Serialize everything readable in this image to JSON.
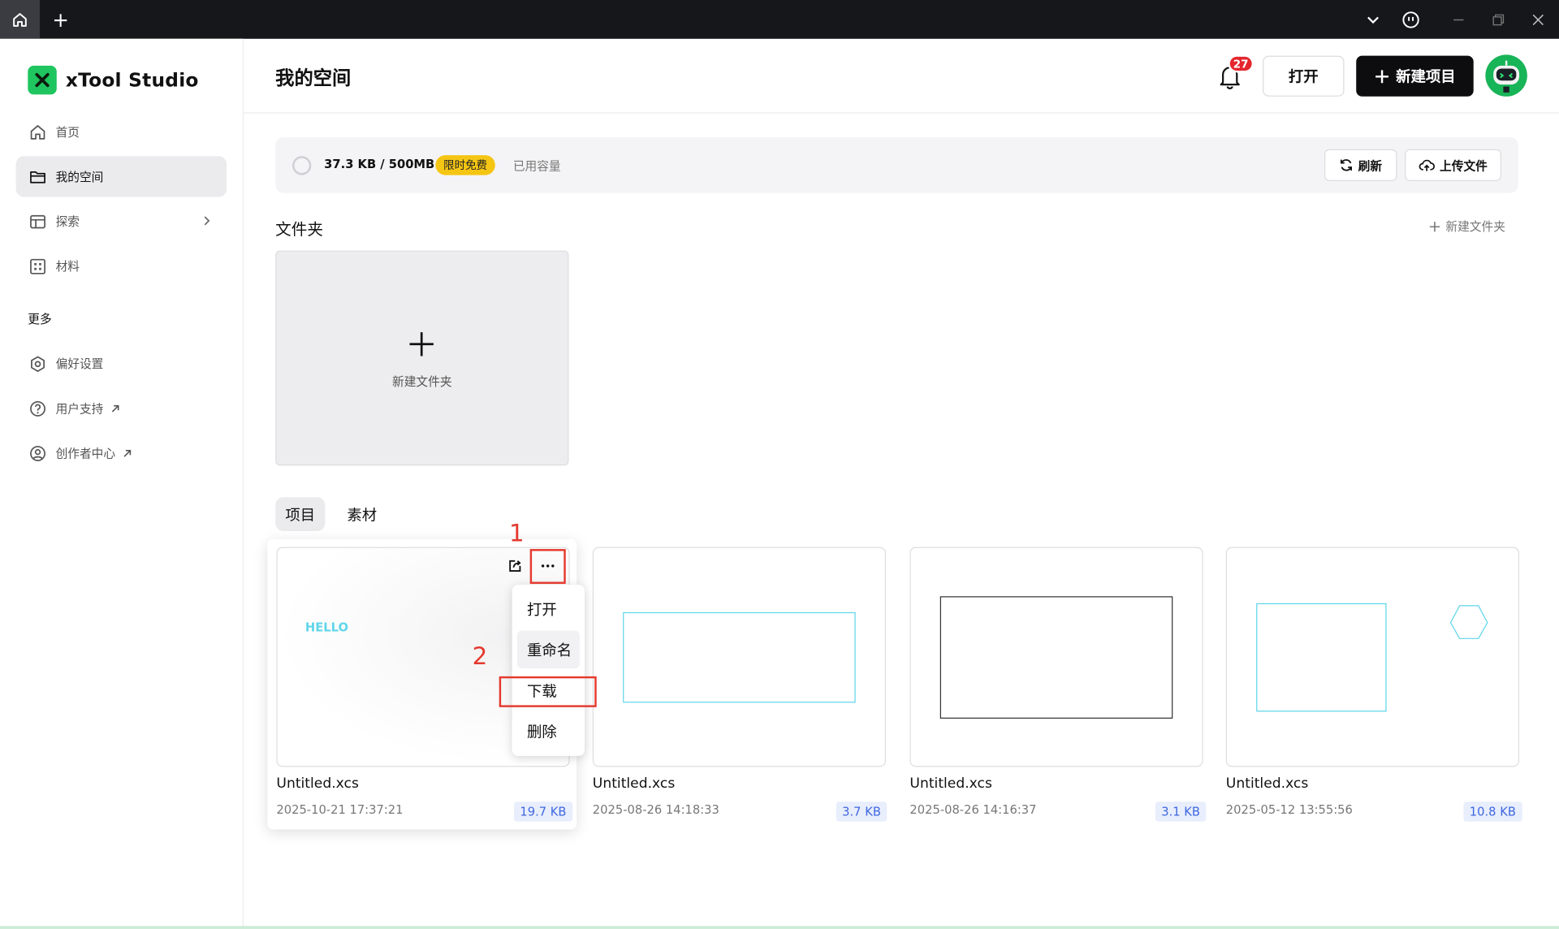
{
  "window": {
    "add_tab_glyph": "+"
  },
  "app": {
    "name": "xTool Studio"
  },
  "sidebar": {
    "items": [
      {
        "label": "首页",
        "icon": "home-icon"
      },
      {
        "label": "我的空间",
        "icon": "folder-icon",
        "active": true
      },
      {
        "label": "探索",
        "icon": "explore-icon",
        "has_chevron": true
      },
      {
        "label": "材料",
        "icon": "grid-icon"
      }
    ],
    "more_label": "更多",
    "more_items": [
      {
        "label": "偏好设置",
        "icon": "settings-icon"
      },
      {
        "label": "用户支持",
        "icon": "help-icon",
        "external": true
      },
      {
        "label": "创作者中心",
        "icon": "user-circle-icon",
        "external": true
      }
    ]
  },
  "header": {
    "title": "我的空间",
    "notification_count": "27",
    "open_label": "打开",
    "new_project_label": "新建项目"
  },
  "storage": {
    "usage": "37.3 KB / 500MB",
    "badge": "限时免费",
    "used_label": "已用容量",
    "refresh_label": "刷新",
    "upload_label": "上传文件"
  },
  "folders": {
    "title": "文件夹",
    "new_folder_link": "新建文件夹",
    "new_folder_card": "新建文件夹"
  },
  "tabs": [
    {
      "label": "项目",
      "active": true
    },
    {
      "label": "素材",
      "active": false
    }
  ],
  "projects": [
    {
      "name": "Untitled.xcs",
      "date": "2025-10-21 17:37:21",
      "size": "19.7 KB",
      "thumb_text": "HELLO"
    },
    {
      "name": "Untitled.xcs",
      "date": "2025-08-26 14:18:33",
      "size": "3.7 KB"
    },
    {
      "name": "Untitled.xcs",
      "date": "2025-08-26 14:16:37",
      "size": "3.1 KB"
    },
    {
      "name": "Untitled.xcs",
      "date": "2025-05-12 13:55:56",
      "size": "10.8 KB"
    }
  ],
  "context_menu": {
    "items": [
      "打开",
      "重命名",
      "下载",
      "删除"
    ]
  },
  "annotations": {
    "step1": "1",
    "step2": "2"
  },
  "colors": {
    "accent_green": "#1fc55f",
    "annotation_red": "#e43a2f",
    "badge_red": "#e5262d",
    "free_badge": "#f5c514",
    "size_badge_text": "#3f67e0",
    "thumb_cyan": "#5fd6ea"
  }
}
